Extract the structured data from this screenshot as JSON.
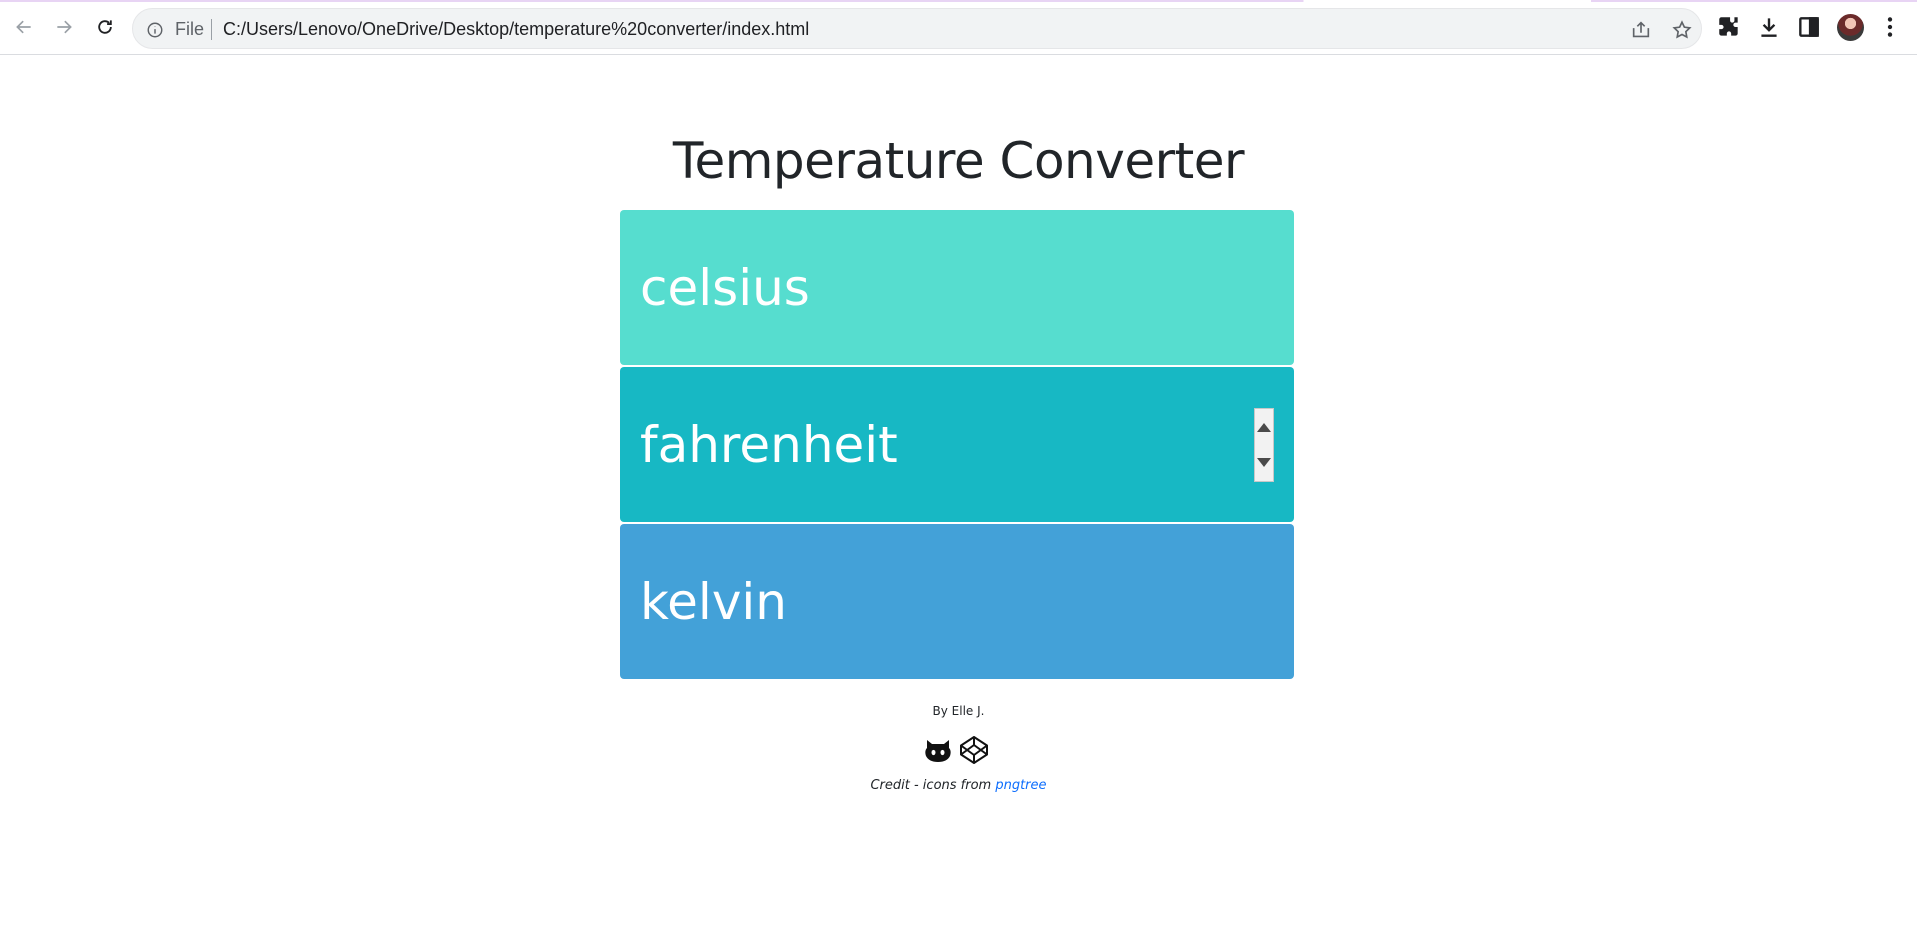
{
  "browser": {
    "scheme_label": "File",
    "url": "C:/Users/Lenovo/OneDrive/Desktop/temperature%20converter/index.html",
    "icons": [
      "back-arrow-icon",
      "forward-arrow-icon",
      "reload-icon",
      "info-icon",
      "share-icon",
      "star-icon",
      "extensions-icon",
      "download-icon",
      "side-panel-icon",
      "profile-avatar",
      "menu-icon"
    ]
  },
  "page": {
    "title": "Temperature Converter",
    "fields": {
      "celsius": {
        "placeholder": "celsius",
        "color": "#56ddcf"
      },
      "fahrenheit": {
        "placeholder": "fahrenheit",
        "color": "#17b8c4"
      },
      "kelvin": {
        "placeholder": "kelvin",
        "color": "#43a1d8"
      }
    },
    "byline": "By Elle J.",
    "footer_icons": [
      "github-icon",
      "codepen-icon"
    ],
    "credit_prefix": "Credit - icons from ",
    "credit_link": "pngtree"
  }
}
